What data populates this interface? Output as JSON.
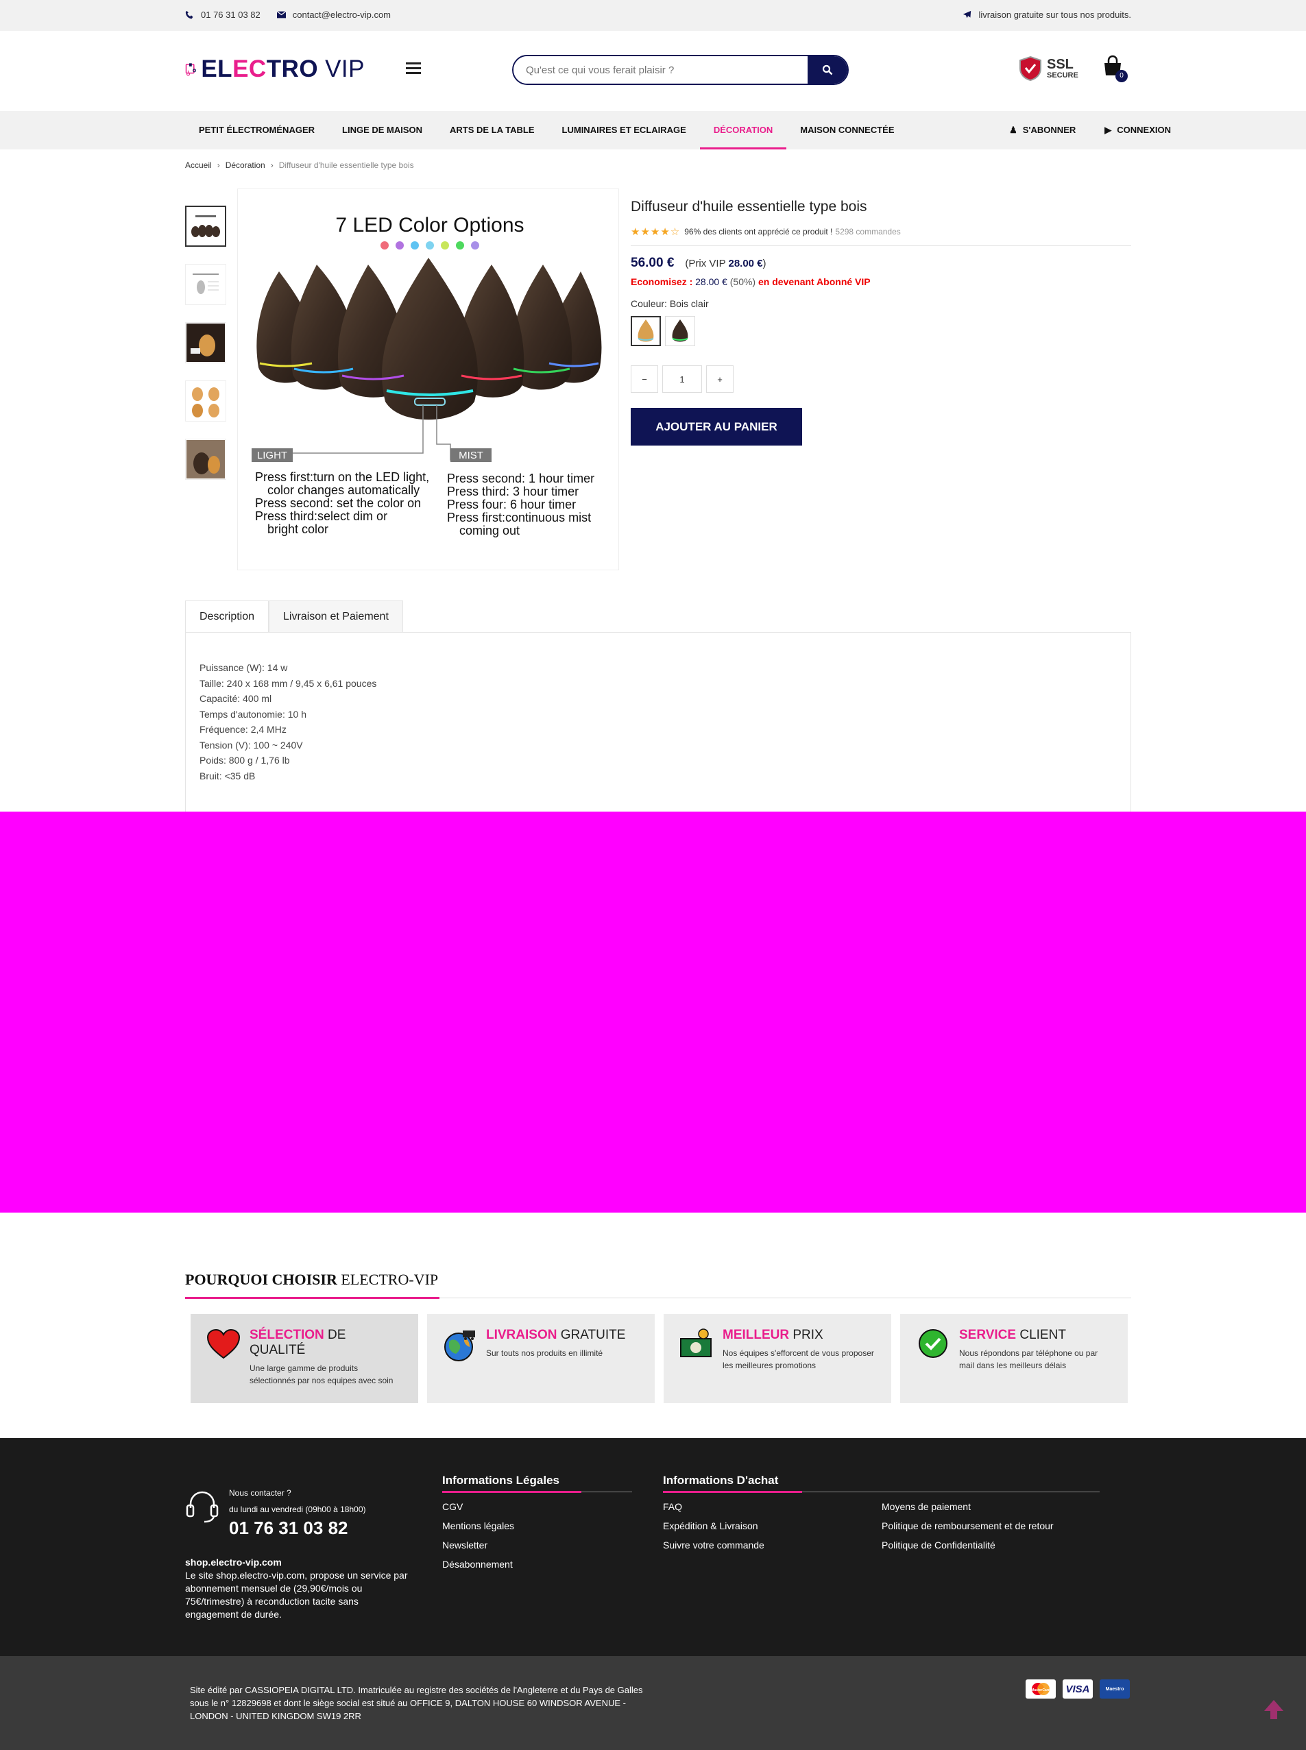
{
  "topbar": {
    "phone": "01 76 31 03 82",
    "email": "contact@electro-vip.com",
    "shipping": "livraison gratuite sur tous nos produits."
  },
  "header": {
    "logo_part1": "EL",
    "logo_part2": "EC",
    "logo_part3": "TRO",
    "logo_part4": "VIP",
    "search_placeholder": "Qu'est ce qui vous ferait plaisir ?",
    "ssl_title": "SSL",
    "ssl_sub": "SECURE",
    "cart_count": "0"
  },
  "nav": {
    "items": [
      {
        "label": "Petit électroménager"
      },
      {
        "label": "Linge de maison"
      },
      {
        "label": "Arts de la table"
      },
      {
        "label": "Luminaires et eclairage"
      },
      {
        "label": "Décoration"
      },
      {
        "label": "Maison connectée"
      }
    ],
    "subscribe": "S'ABONNER",
    "login": "CONNEXION"
  },
  "breadcrumb": {
    "home": "Accueil",
    "category": "Décoration",
    "current": "Diffuseur d'huile essentielle type bois"
  },
  "product": {
    "title": "Diffuseur d'huile essentielle type bois",
    "rating_stars": 4.5,
    "rating_text": "96% des clients ont apprécié ce produit !",
    "orders": "5298 commandes",
    "price": "56.00 €",
    "vip_prefix": "(Prix VIP ",
    "vip_price": "28.00 €",
    "vip_suffix": ")",
    "save_label": "Economisez :",
    "save_amount": "28.00 €",
    "save_percent": "(50%)",
    "save_cta": "en devenant Abonné VIP",
    "color_label": "Couleur:",
    "color_value": "Bois clair",
    "qty_minus": "−",
    "qty_value": "1",
    "qty_plus": "+",
    "add_to_cart": "Ajouter au panier"
  },
  "image": {
    "headline": "7 LED Color Options",
    "light_tag": "LIGHT",
    "mist_tag": "MIST",
    "light_lines": [
      "Press first:turn on the LED light,",
      "color changes automatically",
      "Press second: set the color on",
      "Press third:select dim or",
      "bright color"
    ],
    "mist_lines": [
      "Press second: 1 hour timer",
      "Press third: 3 hour timer",
      "Press four: 6 hour timer",
      "Press first:continuous mist",
      "coming out"
    ],
    "led_colors": [
      "#f06b7a",
      "#b173e0",
      "#5fc3f2",
      "#7fd3f0",
      "#c8e65a",
      "#4ed95e",
      "#a890e8"
    ]
  },
  "tabs": {
    "description": "Description",
    "shipping": "Livraison et Paiement"
  },
  "specs": [
    "Puissance (W): 14 w",
    "Taille: 240 x 168 mm / 9,45 x 6,61 pouces",
    "Capacité: 400 ml",
    "Temps d'autonomie: 10 h",
    "Fréquence: 2,4 MHz",
    "Tension (V): 100 ~ 240V",
    "Poids: 800 g / 1,76 lb",
    "Bruit: <35 dB"
  ],
  "why": {
    "title_bold": "POURQUOI CHOISIR",
    "title_rest": " ELECTRO-VIP",
    "cards": [
      {
        "hl": "SÉLECTION",
        "rest": " DE QUALITÉ",
        "desc": "Une large gamme de produits sélectionnés par nos equipes avec soin"
      },
      {
        "hl": "LIVRAISON",
        "rest": " GRATUITE",
        "desc": "Sur touts nos produits en illimité"
      },
      {
        "hl": "MEILLEUR",
        "rest": " PRIX",
        "desc": "Nos équipes s'efforcent de vous proposer les meilleures promotions"
      },
      {
        "hl": "SERVICE",
        "rest": " CLIENT",
        "desc": "Nous répondons par téléphone ou par mail dans les meilleurs délais"
      }
    ]
  },
  "footer": {
    "contact_q": "Nous contacter ?",
    "hours": "du lundi au vendredi (09h00 à 18h00)",
    "phone": "01 76 31 03 82",
    "site": "shop.electro-vip.com",
    "about": "Le site shop.electro-vip.com, propose un service par abonnement mensuel de (29,90€/mois ou 75€/trimestre) à reconduction tacite sans engagement de durée.",
    "legal_title": "Informations Légales",
    "legal_items": [
      "CGV",
      "Mentions légales",
      "Newsletter",
      "Désabonnement"
    ],
    "buy_title": "Informations D'achat",
    "buy_col1": [
      "FAQ",
      "Expédition & Livraison",
      "Suivre votre commande"
    ],
    "buy_col2": [
      "Moyens de paiement",
      "Politique de remboursement et de retour",
      "Politique de Confidentialité"
    ],
    "bottom_legal": "Site édité par CASSIOPEIA DIGITAL LTD. Imatriculée au registre des sociétés de l'Angleterre et du Pays de Galles sous le n° 12829698 et dont le siège social est situé au OFFICE 9, DALTON HOUSE 60 WINDSOR AVENUE - LONDON - UNITED KINGDOM SW19 2RR",
    "pay_visa": "VISA",
    "pay_maestro": "Maestro",
    "pay_mc": "MasterCard"
  },
  "colors": {
    "navy": "#0f1454",
    "pink": "#e91e8c",
    "magenta_block": "#ff00ff"
  }
}
